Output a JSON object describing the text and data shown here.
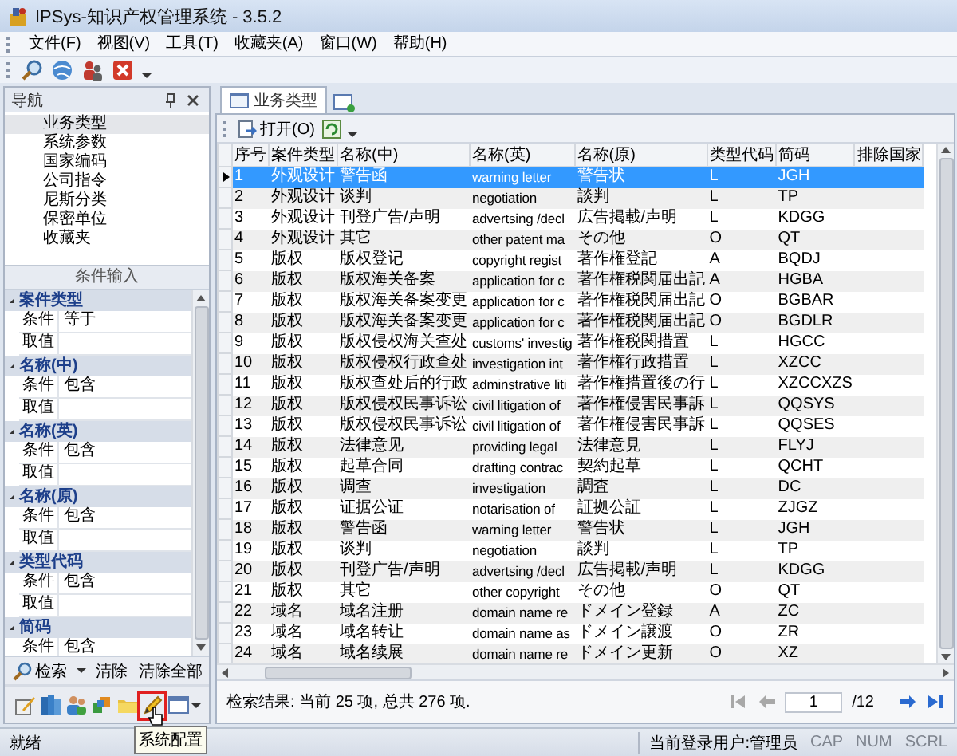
{
  "window": {
    "title": "IPSys-知识产权管理系统 - 3.5.2"
  },
  "menu": [
    "文件(F)",
    "视图(V)",
    "工具(T)",
    "收藏夹(A)",
    "窗口(W)",
    "帮助(H)"
  ],
  "navigation": {
    "title": "导航",
    "items": [
      {
        "label": "业务类型",
        "selected": true
      },
      {
        "label": "系统参数",
        "selected": false
      },
      {
        "label": "国家编码",
        "selected": false
      },
      {
        "label": "公司指令",
        "selected": false
      },
      {
        "label": "尼斯分类",
        "selected": false
      },
      {
        "label": "保密单位",
        "selected": false
      },
      {
        "label": "收藏夹",
        "selected": false
      }
    ]
  },
  "criteria": {
    "title": "条件输入",
    "groups": [
      {
        "title": "案件类型",
        "expanded": true,
        "fields": [
          {
            "label": "条件",
            "value": "等于"
          },
          {
            "label": "取值"
          }
        ]
      },
      {
        "title": "名称(中)",
        "expanded": true,
        "fields": [
          {
            "label": "条件",
            "value": "包含"
          },
          {
            "label": "取值"
          }
        ]
      },
      {
        "title": "名称(英)",
        "expanded": true,
        "fields": [
          {
            "label": "条件",
            "value": "包含"
          },
          {
            "label": "取值"
          }
        ]
      },
      {
        "title": "名称(原)",
        "expanded": true,
        "fields": [
          {
            "label": "条件",
            "value": "包含"
          },
          {
            "label": "取值"
          }
        ]
      },
      {
        "title": "类型代码",
        "expanded": true,
        "fields": [
          {
            "label": "条件",
            "value": "包含"
          },
          {
            "label": "取值"
          }
        ]
      },
      {
        "title": "简码",
        "expanded": true,
        "fields": [
          {
            "label": "条件",
            "value": "包含"
          }
        ]
      }
    ]
  },
  "search_bar": {
    "search": "检索",
    "clear": "清除",
    "clear_all": "清除全部"
  },
  "bottom_toolbar": {
    "tools": [
      {
        "highlighted": false
      },
      {
        "highlighted": false
      },
      {
        "highlighted": false
      },
      {
        "highlighted": false
      },
      {
        "highlighted": false
      },
      {
        "highlighted": true
      },
      {
        "highlighted": false
      }
    ],
    "tooltip": "系统配置"
  },
  "tabs": [
    {
      "label": "业务类型",
      "selected": true
    }
  ],
  "table_toolbar": {
    "open": "打开(O)"
  },
  "table": {
    "columns": [
      "序号",
      "案件类型",
      "名称(中)",
      "名称(英)",
      "名称(原)",
      "类型代码",
      "简码",
      "排除国家"
    ],
    "rows": [
      {
        "selected": true,
        "cells": [
          "1",
          "外观设计",
          "警告函",
          "warning letter",
          "警告状",
          "L",
          "JGH"
        ]
      },
      {
        "selected": false,
        "cells": [
          "2",
          "外观设计",
          "谈判",
          "negotiation",
          "談判",
          "L",
          "TP"
        ]
      },
      {
        "selected": false,
        "cells": [
          "3",
          "外观设计",
          "刊登广告/声明",
          "advertsing /decl",
          "広告掲載/声明",
          "L",
          "KDGG"
        ]
      },
      {
        "selected": false,
        "cells": [
          "4",
          "外观设计",
          "其它",
          "other patent ma",
          "その他",
          "O",
          "QT"
        ]
      },
      {
        "selected": false,
        "cells": [
          "5",
          "版权",
          "版权登记",
          "copyright regist",
          "著作権登記",
          "A",
          "BQDJ"
        ]
      },
      {
        "selected": false,
        "cells": [
          "6",
          "版权",
          "版权海关备案",
          "application for c",
          "著作権税関届出記",
          "A",
          "HGBA"
        ]
      },
      {
        "selected": false,
        "cells": [
          "7",
          "版权",
          "版权海关备案变更",
          "application for c",
          "著作権税関届出記",
          "O",
          "BGBAR"
        ]
      },
      {
        "selected": false,
        "cells": [
          "8",
          "版权",
          "版权海关备案变更",
          "application for c",
          "著作権税関届出記",
          "O",
          "BGDLR"
        ]
      },
      {
        "selected": false,
        "cells": [
          "9",
          "版权",
          "版权侵权海关查处",
          "customs' investig",
          "著作権税関措置",
          "L",
          "HGCC"
        ]
      },
      {
        "selected": false,
        "cells": [
          "10",
          "版权",
          "版权侵权行政查处",
          "investigation int",
          "著作権行政措置",
          "L",
          "XZCC"
        ]
      },
      {
        "selected": false,
        "cells": [
          "11",
          "版权",
          "版权查处后的行政",
          "adminstrative liti",
          "著作権措置後の行",
          "L",
          "XZCCXZS"
        ]
      },
      {
        "selected": false,
        "cells": [
          "12",
          "版权",
          "版权侵权民事诉讼",
          "civil litigation of",
          "著作権侵害民事訴",
          "L",
          "QQSYS"
        ]
      },
      {
        "selected": false,
        "cells": [
          "13",
          "版权",
          "版权侵权民事诉讼",
          "civil litigation of",
          "著作権侵害民事訴",
          "L",
          "QQSES"
        ]
      },
      {
        "selected": false,
        "cells": [
          "14",
          "版权",
          "法律意见",
          "providing legal",
          "法律意見",
          "L",
          "FLYJ"
        ]
      },
      {
        "selected": false,
        "cells": [
          "15",
          "版权",
          "起草合同",
          "drafting contrac",
          "契約起草",
          "L",
          "QCHT"
        ]
      },
      {
        "selected": false,
        "cells": [
          "16",
          "版权",
          "调查",
          "investigation",
          "調査",
          "L",
          "DC"
        ]
      },
      {
        "selected": false,
        "cells": [
          "17",
          "版权",
          "证据公证",
          "notarisation of",
          "証拠公証",
          "L",
          "ZJGZ"
        ]
      },
      {
        "selected": false,
        "cells": [
          "18",
          "版权",
          "警告函",
          "warning letter",
          "警告状",
          "L",
          "JGH"
        ]
      },
      {
        "selected": false,
        "cells": [
          "19",
          "版权",
          "谈判",
          "negotiation",
          "談判",
          "L",
          "TP"
        ]
      },
      {
        "selected": false,
        "cells": [
          "20",
          "版权",
          "刊登广告/声明",
          "advertsing /decl",
          "広告掲載/声明",
          "L",
          "KDGG"
        ]
      },
      {
        "selected": false,
        "cells": [
          "21",
          "版权",
          "其它",
          "other copyright",
          "その他",
          "O",
          "QT"
        ]
      },
      {
        "selected": false,
        "cells": [
          "22",
          "域名",
          "域名注册",
          "domain name re",
          "ドメイン登録",
          "A",
          "ZC"
        ]
      },
      {
        "selected": false,
        "cells": [
          "23",
          "域名",
          "域名转让",
          "domain name as",
          "ドメイン譲渡",
          "O",
          "ZR"
        ]
      },
      {
        "selected": false,
        "cells": [
          "24",
          "域名",
          "域名续展",
          "domain name re",
          "ドメイン更新",
          "O",
          "XZ"
        ]
      }
    ]
  },
  "footer": {
    "summary": "检索结果: 当前 25 项, 总共 276 项.",
    "page": "1",
    "total": "/12",
    "pager": [
      {
        "kind": "first",
        "disabled": true
      },
      {
        "kind": "prev",
        "disabled": true
      },
      {
        "kind": "next",
        "disabled": false
      },
      {
        "kind": "last",
        "disabled": false
      }
    ]
  },
  "status_bar": {
    "message": "就绪",
    "user": "当前登录用户:管理员",
    "indicators": [
      {
        "label": "CAP",
        "on": false
      },
      {
        "label": "NUM",
        "on": false
      },
      {
        "label": "SCRL",
        "on": false
      }
    ]
  }
}
